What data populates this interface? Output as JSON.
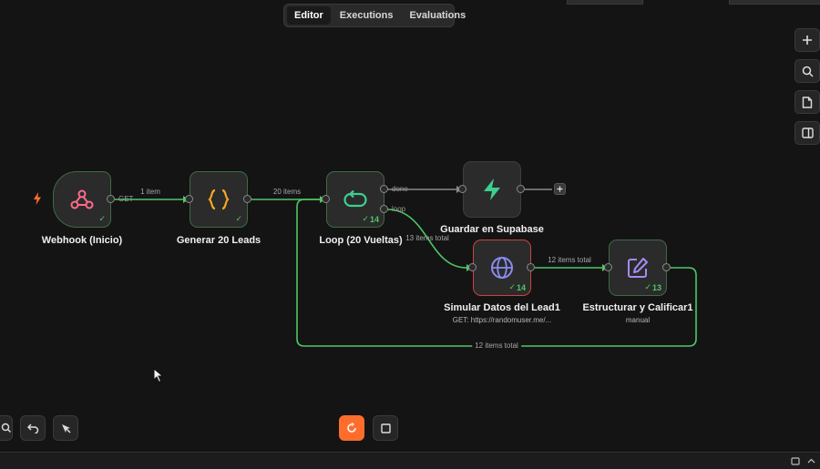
{
  "tabs": [
    {
      "label": "Editor",
      "active": true
    },
    {
      "label": "Executions",
      "active": false
    },
    {
      "label": "Evaluations",
      "active": false
    }
  ],
  "nodes": {
    "webhook": {
      "label": "Webhook (Inicio)",
      "port_label": "GET"
    },
    "generar": {
      "label": "Generar 20 Leads"
    },
    "loop": {
      "label": "Loop (20 Vueltas)",
      "count": "14",
      "done_label": "done",
      "loop_label": "loop"
    },
    "supabase": {
      "label": "Guardar en Supabase"
    },
    "simular": {
      "label": "Simular Datos del Lead1",
      "subtitle": "GET: https://randomuser.me/...",
      "count": "14"
    },
    "estructurar": {
      "label": "Estructurar y Calificar1",
      "subtitle": "manual",
      "count": "13"
    }
  },
  "edges": {
    "webhook_generar": "1 item",
    "generar_loop": "20 items",
    "loop_simular": "13 items total",
    "simular_estructurar": "12 items total",
    "estructurar_loop": "12 items total"
  },
  "colors": {
    "canvas": "#141414",
    "node": "#2b2b2b",
    "success": "#4ec767",
    "error": "#c8453c",
    "accent": "#ff6d2d",
    "trigger": "#ff6d2d",
    "webhook_icon": "#ff6b8a",
    "code_icon": "#f5a623",
    "supabase_icon": "#3ecf8e",
    "globe_icon": "#8b8cf0",
    "edit_icon": "#a58bf5"
  }
}
